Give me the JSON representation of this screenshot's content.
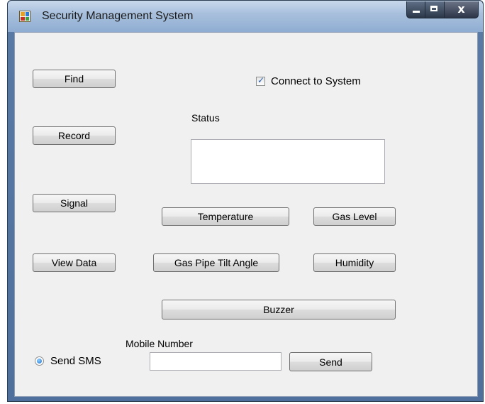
{
  "window": {
    "title": "Security Management System",
    "controls": {
      "minimize": "minimize",
      "maximize": "maximize",
      "close": "x"
    }
  },
  "buttons": {
    "find": "Find",
    "record": "Record",
    "signal": "Signal",
    "view_data": "View Data",
    "temperature": "Temperature",
    "gas_level": "Gas Level",
    "gas_pipe_tilt_angle": "Gas Pipe Tilt Angle",
    "humidity": "Humidity",
    "buzzer": "Buzzer",
    "send": "Send"
  },
  "connect": {
    "label": "Connect to System",
    "checked": true
  },
  "status": {
    "label": "Status",
    "value": ""
  },
  "sms": {
    "label": "Send SMS",
    "selected": true
  },
  "mobile": {
    "label": "Mobile Number",
    "value": ""
  },
  "colors": {
    "titlebar": "#a9c0dd",
    "client_bg": "#f0f0f0",
    "accent": "#2a5fb0"
  }
}
